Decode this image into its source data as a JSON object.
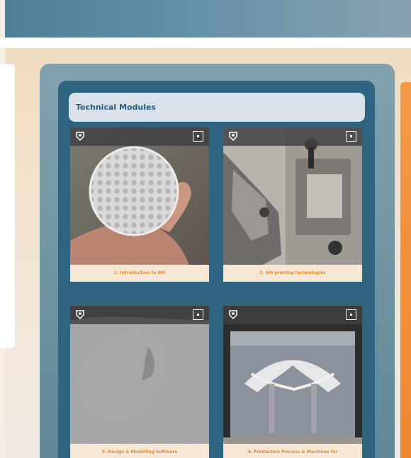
{
  "page": {
    "panel_title": "Technical Modules",
    "modules": [
      {
        "caption": "1. Introduction to AM"
      },
      {
        "caption": "2. AM printing technologies"
      },
      {
        "caption": "3. Design & Modelling Software"
      },
      {
        "caption": "4. Production Process & Machines for"
      }
    ]
  },
  "colors": {
    "brand_header": "#4f7f97",
    "panel_bg": "#2f6480",
    "title_bar_bg": "#d8e2e8",
    "caption_text": "#e08c3a",
    "accent_orange": "#f39a4a"
  },
  "icons": {
    "tag": "tag-icon",
    "expand": "expand-icon"
  }
}
